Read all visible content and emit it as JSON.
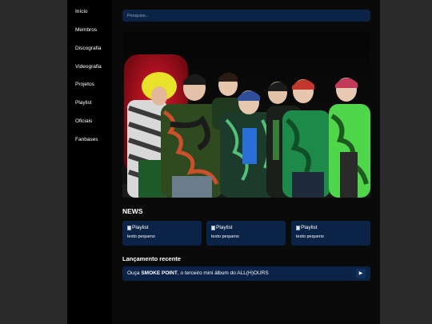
{
  "nav": {
    "items": [
      {
        "label": "Início"
      },
      {
        "label": "Membros"
      },
      {
        "label": "Discografia"
      },
      {
        "label": "Videografia"
      },
      {
        "label": "Projetos"
      },
      {
        "label": "Playlist"
      },
      {
        "label": "Oficiais"
      },
      {
        "label": "Fanbases"
      }
    ]
  },
  "search": {
    "placeholder": "Pesquise..."
  },
  "news": {
    "title": "NEWS",
    "cards": [
      {
        "img_alt": "Playlist",
        "text": "texto pequeno"
      },
      {
        "img_alt": "Playlist",
        "text": "texto pequeno"
      },
      {
        "img_alt": "Playlist",
        "text": "texto pequeno"
      }
    ]
  },
  "release": {
    "title": "Lançamento recente",
    "prefix": "Ouça ",
    "album": "SMOKE POINT",
    "suffix": ", o terceiro mini álbum do ALL(H)OURS",
    "play_label": "▶"
  },
  "colors": {
    "card_bg": "#0b2347",
    "sidebar_bg": "#000000",
    "page_bg": "#2a2a2a",
    "main_bg": "#0a0a0a"
  }
}
